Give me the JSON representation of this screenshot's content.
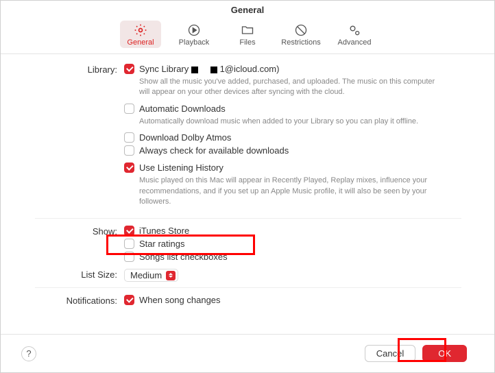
{
  "title": "General",
  "toolbar": [
    {
      "id": "general",
      "label": "General",
      "selected": true
    },
    {
      "id": "playback",
      "label": "Playback",
      "selected": false
    },
    {
      "id": "files",
      "label": "Files",
      "selected": false
    },
    {
      "id": "restrictions",
      "label": "Restrictions",
      "selected": false
    },
    {
      "id": "advanced",
      "label": "Advanced",
      "selected": false
    }
  ],
  "sections": {
    "library": {
      "label": "Library:",
      "sync": {
        "label_before": "Sync Library",
        "label_after": "1@icloud.com)",
        "checked": true,
        "desc": "Show all the music you've added, purchased, and uploaded. The music on this computer will appear on your other devices after syncing with the cloud."
      },
      "auto_dl": {
        "label": "Automatic Downloads",
        "checked": false,
        "desc": "Automatically download music when added to your Library so you can play it offline."
      },
      "atmos": {
        "label": "Download Dolby Atmos",
        "checked": false
      },
      "always_check": {
        "label": "Always check for available downloads",
        "checked": false
      },
      "listening": {
        "label": "Use Listening History",
        "checked": true,
        "desc": "Music played on this Mac will appear in Recently Played, Replay mixes, influence your recommendations, and if you set up an Apple Music profile, it will also be seen by your followers."
      }
    },
    "show": {
      "label": "Show:",
      "itunes": {
        "label": "iTunes Store",
        "checked": true
      },
      "star": {
        "label": "Star ratings",
        "checked": false
      },
      "songs_cb": {
        "label": "Songs list checkboxes",
        "checked": false
      }
    },
    "list_size": {
      "label": "List Size:",
      "value": "Medium"
    },
    "notifications": {
      "label": "Notifications:",
      "song_change": {
        "label": "When song changes",
        "checked": true
      }
    }
  },
  "footer": {
    "help": "?",
    "cancel": "Cancel",
    "ok": "OK"
  }
}
